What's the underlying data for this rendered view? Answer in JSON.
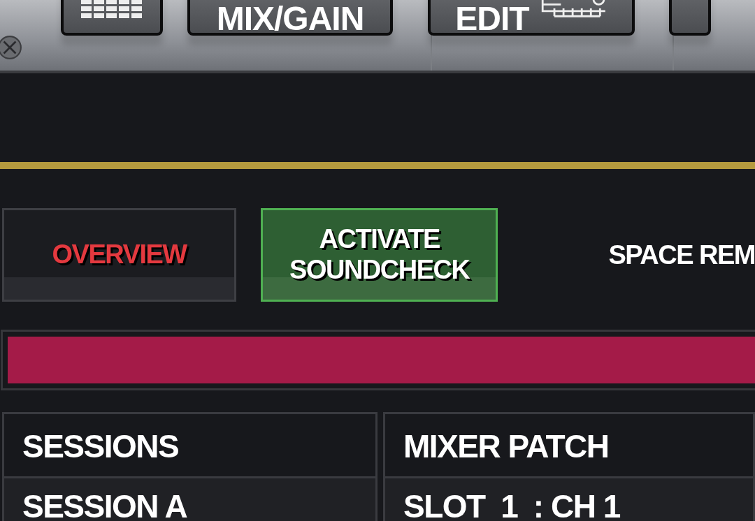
{
  "toolbar": {
    "buttons": [
      {
        "kind": "meter"
      },
      {
        "kind": "text",
        "label": "MIX/GAIN"
      },
      {
        "kind": "edit",
        "label": "EDIT"
      },
      {
        "kind": "blank"
      }
    ]
  },
  "modes": [
    {
      "label": "OVERVIEW",
      "selected": true
    },
    {
      "label": "ACTIVATE SOUNDCHECK",
      "selected": false,
      "on": true
    }
  ],
  "space_remaining": "SPACE REM",
  "table": {
    "columns": [
      "SESSIONS",
      "MIXER PATCH"
    ],
    "rows": [
      [
        "SESSION A",
        "SLOT  1  : CH 1"
      ]
    ]
  }
}
